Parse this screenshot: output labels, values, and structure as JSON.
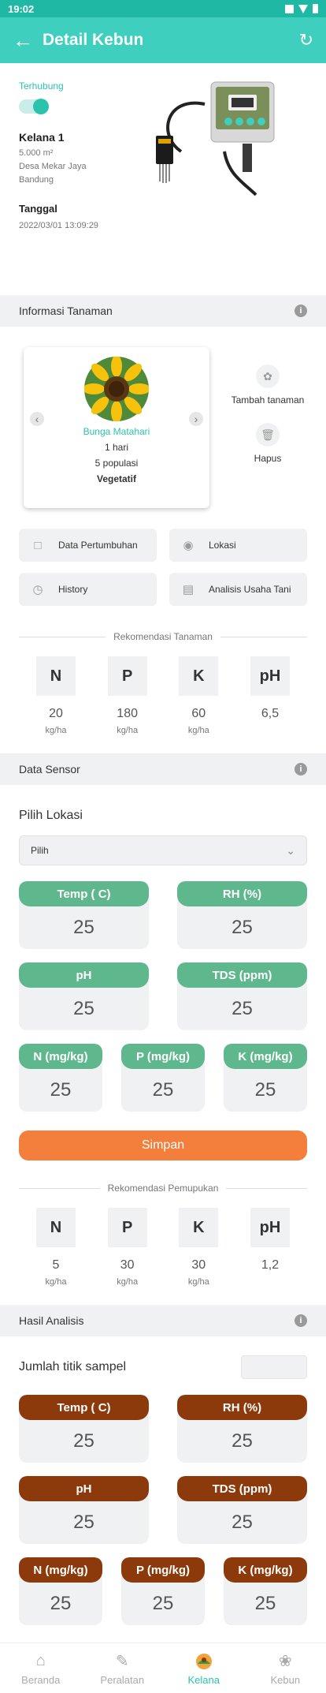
{
  "status_bar": {
    "time": "19:02"
  },
  "app_bar": {
    "title": "Detail Kebun"
  },
  "connection": {
    "status": "Terhubung",
    "connected": true,
    "name": "Kelana 1",
    "area": "5.000 m²",
    "village": "Desa Mekar Jaya",
    "city": "Bandung",
    "date_label": "Tanggal",
    "date_value": "2022/03/01   13:09:29"
  },
  "tanaman": {
    "section_title": "Informasi Tanaman",
    "plant_name": "Bunga Matahari",
    "duration": "1 hari",
    "population": "5 populasi",
    "stage": "Vegetatif",
    "add_label": "Tambah tanaman",
    "delete_label": "Hapus"
  },
  "menu": {
    "pertumbuhan": "Data Pertumbuhan",
    "lokasi": "Lokasi",
    "history": "History",
    "analisis": "Analisis Usaha Tani"
  },
  "rekomendasi_tanaman": {
    "title": "Rekomendasi Tanaman",
    "items": [
      {
        "label": "N",
        "value": "20",
        "unit": "kg/ha"
      },
      {
        "label": "P",
        "value": "180",
        "unit": "kg/ha"
      },
      {
        "label": "K",
        "value": "60",
        "unit": "kg/ha"
      },
      {
        "label": "pH",
        "value": "6,5",
        "unit": ""
      }
    ]
  },
  "sensor": {
    "section_title": "Data Sensor",
    "pilih_lokasi": "Pilih Lokasi",
    "select_value": "Pilih",
    "temp_label": "Temp ( C)",
    "temp_value": "25",
    "rh_label": "RH (%)",
    "rh_value": "25",
    "ph_label": "pH",
    "ph_value": "25",
    "tds_label": "TDS (ppm)",
    "tds_value": "25",
    "n_label": "N (mg/kg)",
    "n_value": "25",
    "p_label": "P (mg/kg)",
    "p_value": "25",
    "k_label": "K (mg/kg)",
    "k_value": "25",
    "save_label": "Simpan"
  },
  "rekomendasi_pemupukan": {
    "title": "Rekomendasi Pemupukan",
    "items": [
      {
        "label": "N",
        "value": "5",
        "unit": "kg/ha"
      },
      {
        "label": "P",
        "value": "30",
        "unit": "kg/ha"
      },
      {
        "label": "K",
        "value": "30",
        "unit": "kg/ha"
      },
      {
        "label": "pH",
        "value": "1,2",
        "unit": ""
      }
    ]
  },
  "hasil": {
    "section_title": "Hasil Analisis",
    "sample_label": "Jumlah titik sampel",
    "temp_label": "Temp ( C)",
    "temp_value": "25",
    "rh_label": "RH (%)",
    "rh_value": "25",
    "ph_label": "pH",
    "ph_value": "25",
    "tds_label": "TDS (ppm)",
    "tds_value": "25",
    "n_label": "N (mg/kg)",
    "n_value": "25",
    "p_label": "P (mg/kg)",
    "p_value": "25",
    "k_label": "K (mg/kg)",
    "k_value": "25"
  },
  "nav": {
    "beranda": "Beranda",
    "peralatan": "Peralatan",
    "kelana": "Kelana",
    "kebun": "Kebun",
    "active": "kelana"
  },
  "colors": {
    "primary": "#3ecfbf",
    "accent_text": "#2bc2ae",
    "sensor_header": "#5fb78d",
    "analysis_header": "#8c3a0c",
    "save_button": "#f47e3b"
  }
}
